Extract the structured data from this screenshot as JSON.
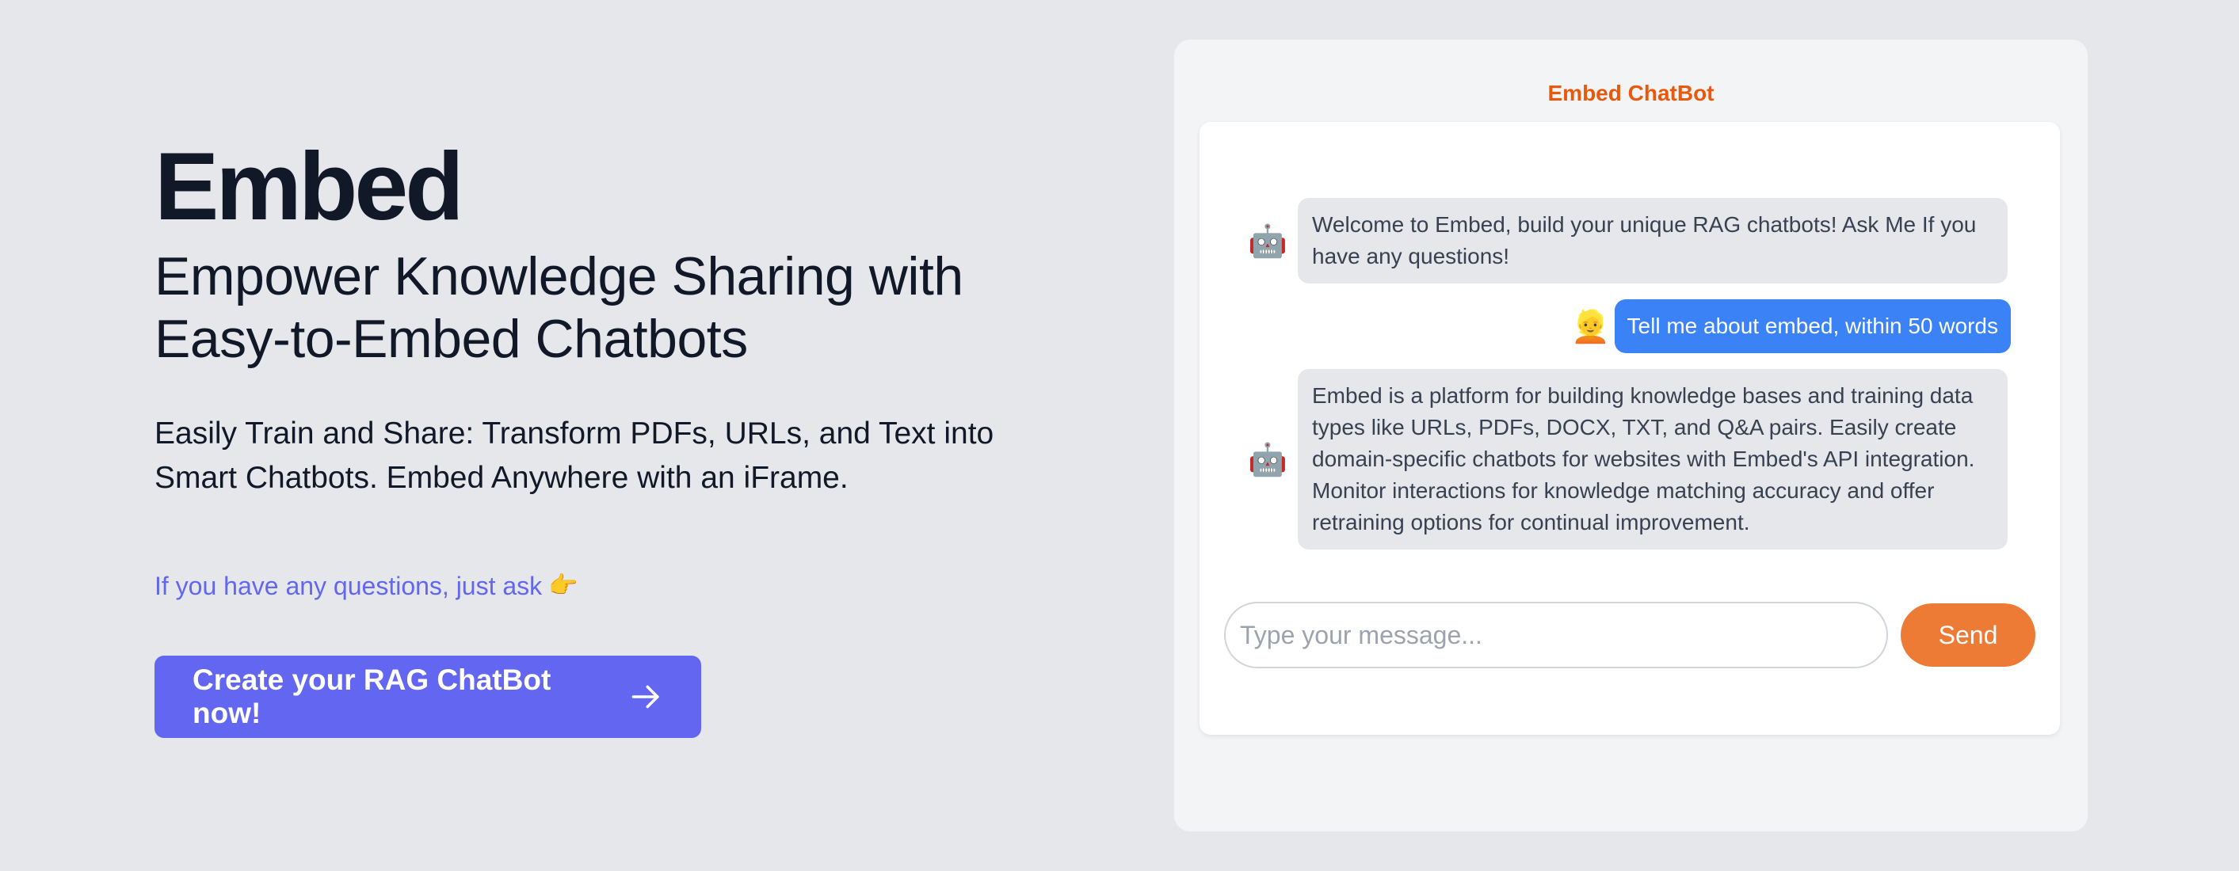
{
  "hero": {
    "brand": "Embed",
    "tagline_line1": "Empower Knowledge Sharing with",
    "tagline_line2": "Easy-to-Embed Chatbots",
    "desc_line1": "Easily Train and Share: Transform PDFs, URLs, and Text into",
    "desc_line2": "Smart Chatbots. Embed Anywhere with an iFrame.",
    "ask_text": "If you have any questions, just ask",
    "ask_icon": "👉",
    "cta_label": "Create your RAG ChatBot now!",
    "cta_icon": "arrow-right-icon"
  },
  "widget": {
    "title": "Embed ChatBot",
    "bot_avatar": "🤖",
    "user_avatar": "👱",
    "messages": [
      {
        "role": "bot",
        "text": "Welcome to Embed, build your unique RAG chatbots!   Ask Me If you have any questions!"
      },
      {
        "role": "user",
        "text": "Tell me about embed, within 50 words"
      },
      {
        "role": "bot",
        "text": "Embed is a platform for building knowledge bases and training data types like URLs, PDFs, DOCX, TXT, and Q&A pairs. Easily create domain-specific chatbots for websites with Embed's API integration. Monitor interactions for knowledge matching accuracy and offer retraining options for continual improvement."
      }
    ],
    "input": {
      "placeholder": "Type your message...",
      "value": ""
    },
    "send_label": "Send"
  },
  "colors": {
    "background": "#e5e7eb",
    "accent_indigo": "#6366f1",
    "title_orange": "#ea580c",
    "send_orange": "#ed7a35",
    "user_bubble": "#3b82f6",
    "bot_bubble": "#e5e7eb"
  }
}
